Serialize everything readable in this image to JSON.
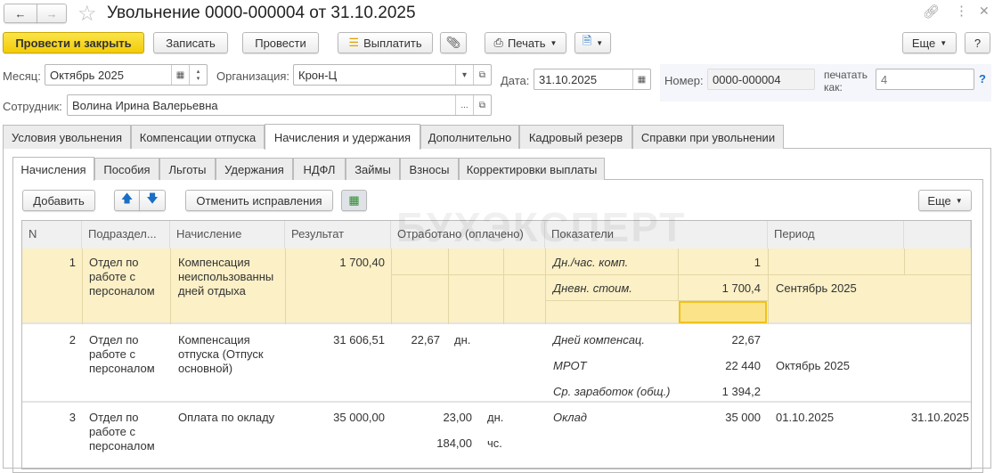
{
  "title": "Увольнение 0000-000004 от 31.10.2025",
  "toolbar": {
    "post_close": "Провести и закрыть",
    "write": "Записать",
    "post": "Провести",
    "pay": "Выплатить",
    "print": "Печать",
    "more": "Еще",
    "help": "?"
  },
  "header": {
    "month_label": "Месяц:",
    "month_value": "Октябрь 2025",
    "org_label": "Организация:",
    "org_value": "Крон-Ц",
    "date_label": "Дата:",
    "date_value": "31.10.2025",
    "number_label": "Номер:",
    "number_value": "0000-000004",
    "print_as_label": "печатать как:",
    "print_as_placeholder": "4",
    "help_link": "?",
    "employee_label": "Сотрудник:",
    "employee_value": "Волина Ирина Валерьевна",
    "ellipsis": "..."
  },
  "tabs": [
    "Условия увольнения",
    "Компенсации отпуска",
    "Начисления и удержания",
    "Дополнительно",
    "Кадровый резерв",
    "Справки при увольнении"
  ],
  "subtabs": [
    "Начисления",
    "Пособия",
    "Льготы",
    "Удержания",
    "НДФЛ",
    "Займы",
    "Взносы",
    "Корректировки выплаты"
  ],
  "table_toolbar": {
    "add": "Добавить",
    "cancel_fix": "Отменить исправления",
    "more": "Еще"
  },
  "watermark": "БУХЭКСПЕРТ",
  "columns": [
    "N",
    "Подраздел...",
    "Начисление",
    "Результат",
    "Отработано (оплачено)",
    "Показатели",
    "Период"
  ],
  "rows": [
    {
      "n": "1",
      "dept": "Отдел по работе с персоналом",
      "accrual": "Компенсация неиспользованны дней отдыха",
      "result": "1 700,40",
      "worked": [],
      "indicators": [
        {
          "name": "Дн./час. комп.",
          "value": "1"
        },
        {
          "name": "Дневн. стоим.",
          "value": "1 700,4"
        }
      ],
      "period_start": "Сентябрь 2025",
      "period_end": ""
    },
    {
      "n": "2",
      "dept": "Отдел по работе с персоналом",
      "accrual": "Компенсация отпуска (Отпуск основной)",
      "result": "31 606,51",
      "worked": [
        {
          "value": "22,67",
          "unit": "дн."
        }
      ],
      "indicators": [
        {
          "name": "Дней компенсац.",
          "value": "22,67"
        },
        {
          "name": "МРОТ",
          "value": "22 440"
        },
        {
          "name": "Ср. заработок (общ.)",
          "value": "1 394,2"
        }
      ],
      "period_start": "Октябрь 2025",
      "period_end": ""
    },
    {
      "n": "3",
      "dept": "Отдел по работе с персоналом",
      "accrual": "Оплата по окладу",
      "result": "35 000,00",
      "worked": [
        {
          "value": "23,00",
          "unit": "дн."
        },
        {
          "value": "184,00",
          "unit": "чс."
        }
      ],
      "indicators": [
        {
          "name": "Оклад",
          "value": "35 000"
        }
      ],
      "period_start": "01.10.2025",
      "period_end": "31.10.2025"
    }
  ]
}
